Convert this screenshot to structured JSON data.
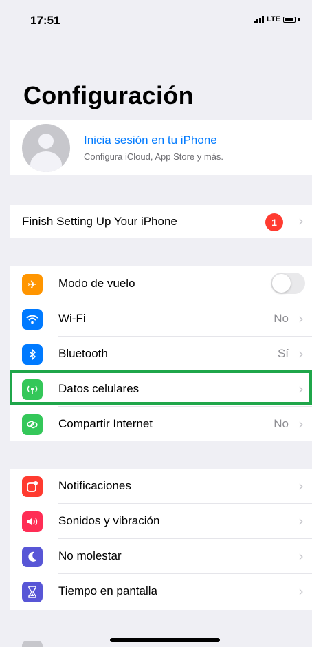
{
  "status": {
    "time": "17:51",
    "network": "LTE"
  },
  "title": "Configuración",
  "profile": {
    "title": "Inicia sesión en tu iPhone",
    "subtitle": "Configura iCloud, App Store y más."
  },
  "finish": {
    "label": "Finish Setting Up Your iPhone",
    "badge": "1"
  },
  "group1": [
    {
      "label": "Modo de vuelo",
      "icon": "airplane-icon",
      "color": "#ff9500",
      "toggle": false
    },
    {
      "label": "Wi-Fi",
      "value": "No",
      "icon": "wifi-icon",
      "color": "#007aff"
    },
    {
      "label": "Bluetooth",
      "value": "Sí",
      "icon": "bluetooth-icon",
      "color": "#007aff"
    },
    {
      "label": "Datos celulares",
      "value": "",
      "icon": "cellular-icon",
      "color": "#34c759"
    },
    {
      "label": "Compartir Internet",
      "value": "No",
      "icon": "hotspot-icon",
      "color": "#34c759"
    }
  ],
  "group2": [
    {
      "label": "Notificaciones",
      "icon": "notifications-icon",
      "color": "#ff3b30"
    },
    {
      "label": "Sonidos y vibración",
      "icon": "sounds-icon",
      "color": "#ff2d55"
    },
    {
      "label": "No molestar",
      "icon": "moon-icon",
      "color": "#5856d6"
    },
    {
      "label": "Tiempo en pantalla",
      "icon": "hourglass-icon",
      "color": "#5856d6"
    }
  ],
  "chevron": "›"
}
